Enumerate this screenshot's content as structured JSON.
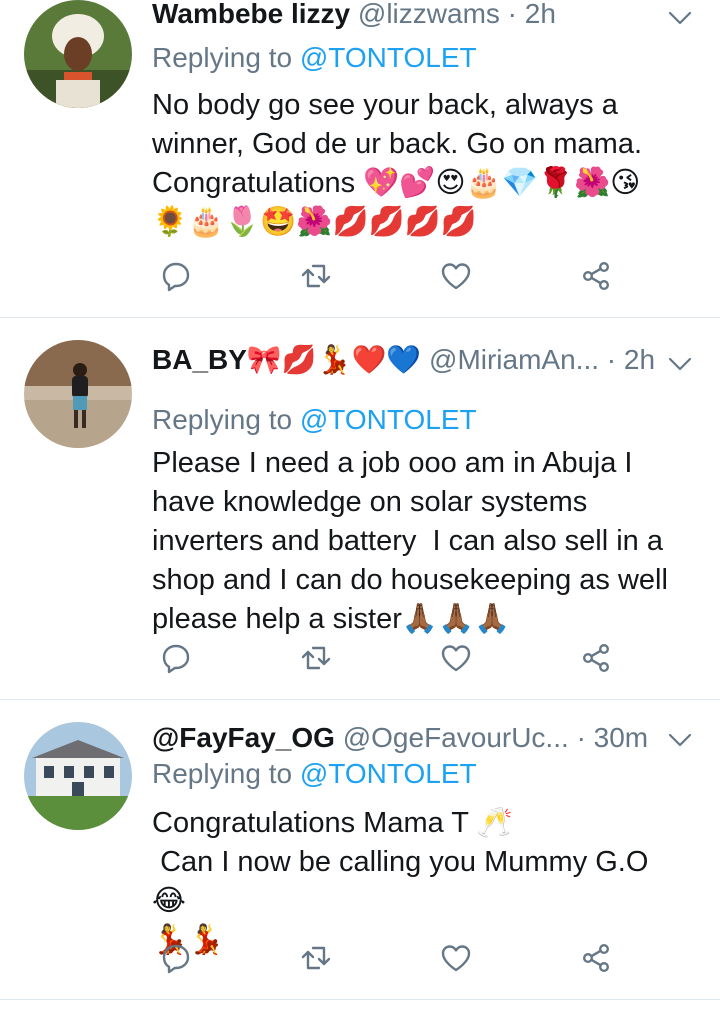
{
  "tweets": [
    {
      "name": "Wambebe lizzy",
      "handle": "@lizzwams",
      "time": "· 2h",
      "replying_prefix": "Replying to ",
      "replying_to": "@TONTOLET",
      "text": "No body go see your back, always a\nwinner, God de ur back. Go on mama.\nCongratulations 💖💕😍🎂💎🌹🌺😘\n🌻🎂🌷🤩🌺💋💋💋💋"
    },
    {
      "name": "BA_BY🎀💋💃❤️💙",
      "handle": "@MiriamAn...",
      "time": "· 2h",
      "replying_prefix": "Replying to ",
      "replying_to": "@TONTOLET",
      "text": "Please I need a job ooo am in Abuja I\nhave knowledge on solar systems\ninverters and battery  I can also sell in a\nshop and I can do housekeeping as well\nplease help a sister🙏🏾🙏🏾🙏🏾"
    },
    {
      "name": "@FayFay_OG",
      "handle": "@OgeFavourUc...",
      "time": "· 30m",
      "replying_prefix": "Replying to ",
      "replying_to": "@TONTOLET",
      "text": "Congratulations Mama T 🥂\n Can I now be calling you Mummy G.O 😂\n💃💃"
    }
  ],
  "icons": {
    "reply": "reply-icon",
    "retweet": "retweet-icon",
    "like": "heart-icon",
    "share": "share-icon",
    "more": "chevron-down-icon"
  },
  "colors": {
    "text": "#14171a",
    "muted": "#657786",
    "accent": "#1da1f2",
    "divider": "#e1e8ed"
  }
}
